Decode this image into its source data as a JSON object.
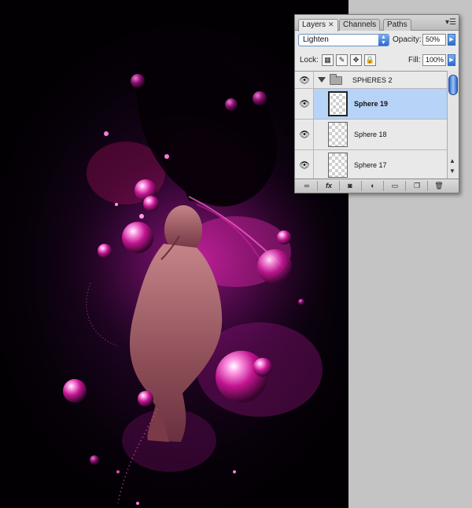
{
  "palette": {
    "tabs": [
      {
        "label": "Layers",
        "active": true
      },
      {
        "label": "Channels",
        "active": false
      },
      {
        "label": "Paths",
        "active": false
      }
    ],
    "close_glyph": "✕",
    "menu_glyph": "▾☰",
    "blend_mode": "Lighten",
    "opacity_label": "Opacity:",
    "opacity_value": "50%",
    "lock_label": "Lock:",
    "fill_label": "Fill:",
    "fill_value": "100%",
    "lock_icons": [
      "lock-transparent-pixels-icon",
      "lock-image-pixels-icon",
      "lock-position-icon",
      "lock-all-icon"
    ],
    "layers": [
      {
        "name": "SPHERES 2",
        "type": "group",
        "expanded": true,
        "visible": true,
        "selected": false
      },
      {
        "name": "Sphere 19",
        "type": "layer",
        "visible": true,
        "selected": true
      },
      {
        "name": "Sphere 18",
        "type": "layer",
        "visible": true,
        "selected": false
      },
      {
        "name": "Sphere 17",
        "type": "layer",
        "visible": true,
        "selected": false
      }
    ],
    "bottom_icons": [
      {
        "name": "link-layers-icon",
        "glyph": "∞"
      },
      {
        "name": "fx-icon",
        "glyph": "fx"
      },
      {
        "name": "add-mask-icon",
        "glyph": "◙"
      },
      {
        "name": "adjustment-layer-icon",
        "glyph": "◐"
      },
      {
        "name": "new-group-icon",
        "glyph": "▭"
      },
      {
        "name": "new-layer-icon",
        "glyph": "❐"
      },
      {
        "name": "delete-layer-icon",
        "glyph": "🗑"
      }
    ],
    "colors": {
      "selected_row": "#b7d3f7",
      "accent": "#2a6ad0"
    }
  },
  "canvas": {
    "artwork": "woman-with-glowing-spheres",
    "colors": {
      "background": "#070109",
      "glow": "#c21fa8",
      "highlight": "#ff8ad8"
    }
  }
}
